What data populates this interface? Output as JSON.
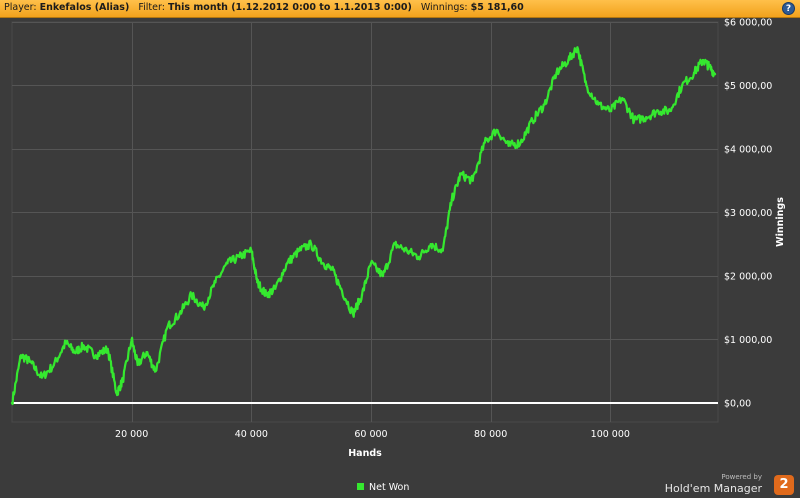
{
  "header": {
    "player_label": "Player:",
    "player_value": "Enkefalos (Alias)",
    "filter_label": "Filter:",
    "filter_value": "This month (1.12.2012 0:00 to 1.1.2013 0:00)",
    "winnings_label": "Winnings:",
    "winnings_value": "$5 181,60",
    "help_glyph": "?"
  },
  "colors": {
    "series": "#35e82f",
    "zero_line": "#ffffff",
    "plot_bg": "#3b3b3b",
    "grid": "#555555",
    "header_bg": "#f2a21c",
    "badge": "#e06a1c"
  },
  "chart_data": {
    "type": "line",
    "title": "",
    "xlabel": "Hands",
    "ylabel": "Winnings",
    "xlim": [
      0,
      118000
    ],
    "ylim": [
      -300,
      6000
    ],
    "x_ticks": [
      20000,
      40000,
      60000,
      80000,
      100000
    ],
    "x_tick_labels": [
      "20 000",
      "40 000",
      "60 000",
      "80 000",
      "100 000"
    ],
    "y_ticks": [
      0,
      1000,
      2000,
      3000,
      4000,
      5000,
      6000
    ],
    "y_tick_labels": [
      "$0,00",
      "$1 000,00",
      "$2 000,00",
      "$3 000,00",
      "$4 000,00",
      "$5 000,00",
      "$6 000,00"
    ],
    "grid": true,
    "legend_position": "bottom",
    "series": [
      {
        "name": "Net Won",
        "x": [
          0,
          1500,
          3000,
          5000,
          7000,
          9000,
          10500,
          12000,
          14000,
          16000,
          17500,
          18500,
          20000,
          21000,
          22500,
          24000,
          26000,
          28000,
          30000,
          32000,
          34000,
          36000,
          38000,
          40000,
          41000,
          42500,
          44000,
          46000,
          48000,
          50000,
          52000,
          53500,
          55000,
          57000,
          58500,
          60000,
          62000,
          64000,
          66000,
          68000,
          70000,
          72000,
          73500,
          75000,
          77000,
          79000,
          81000,
          83000,
          85000,
          87000,
          89000,
          91000,
          93000,
          94500,
          96000,
          98000,
          100000,
          102000,
          104000,
          106000,
          108000,
          110000,
          112000,
          114000,
          115500,
          116500,
          117500
        ],
        "y": [
          0,
          750,
          650,
          400,
          600,
          950,
          800,
          900,
          750,
          850,
          150,
          350,
          1000,
          600,
          800,
          500,
          1200,
          1400,
          1700,
          1500,
          1900,
          2200,
          2300,
          2400,
          1900,
          1700,
          1800,
          2200,
          2400,
          2500,
          2200,
          2100,
          1800,
          1400,
          1700,
          2200,
          2000,
          2500,
          2400,
          2300,
          2500,
          2400,
          3200,
          3600,
          3500,
          4100,
          4300,
          4050,
          4100,
          4450,
          4700,
          5200,
          5400,
          5600,
          5000,
          4700,
          4600,
          4800,
          4450,
          4500,
          4600,
          4600,
          5000,
          5200,
          5400,
          5300,
          5180
        ]
      }
    ]
  },
  "legend": {
    "label": "Net Won"
  },
  "branding": {
    "powered_by": "Powered by",
    "product": "Hold'em Manager",
    "badge": "2"
  }
}
